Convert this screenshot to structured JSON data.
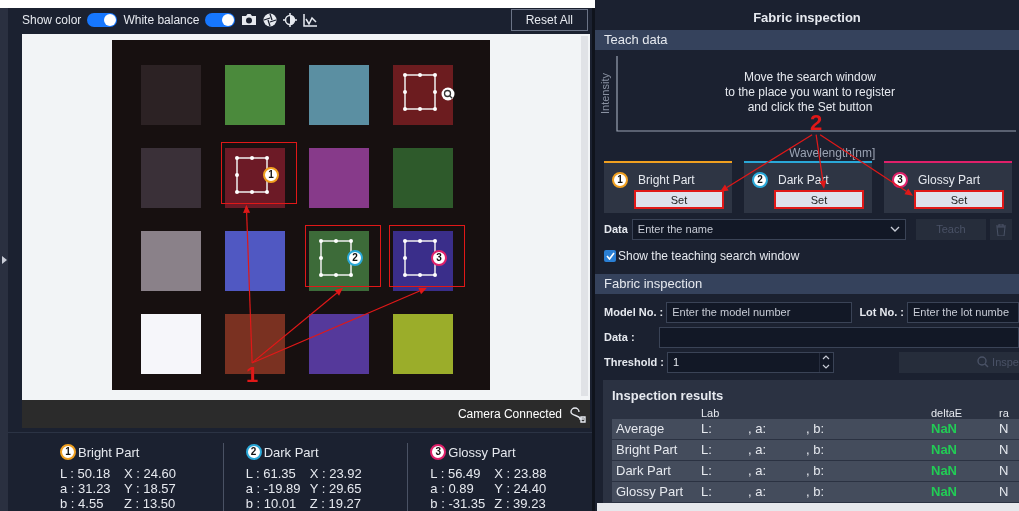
{
  "toolbar": {
    "toggles": [
      {
        "label": "Show color",
        "on": true
      },
      {
        "label": "White balance",
        "on": true
      }
    ],
    "reset_button": "Reset All"
  },
  "camera_image": {
    "patches": [
      {
        "color": "#2c2224",
        "highlighted": false,
        "search_window": false
      },
      {
        "color": "#4b8a3c",
        "highlighted": false,
        "search_window": false
      },
      {
        "color": "#5b8fa2",
        "highlighted": false,
        "search_window": false
      },
      {
        "color": "#6c1c1f",
        "highlighted": false,
        "search_window": true
      },
      {
        "color": "#3a3038",
        "highlighted": false,
        "search_window": false
      },
      {
        "color": "#6c1a26",
        "highlighted": true,
        "search_window": true,
        "marker": {
          "label": "1",
          "color": "#f0a020"
        }
      },
      {
        "color": "#873a8a",
        "highlighted": false,
        "search_window": false
      },
      {
        "color": "#2e5a2b",
        "highlighted": false,
        "search_window": false
      },
      {
        "color": "#8a8189",
        "highlighted": false,
        "search_window": false
      },
      {
        "color": "#5058c2",
        "highlighted": false,
        "search_window": false
      },
      {
        "color": "#3d6b39",
        "highlighted": true,
        "search_window": true,
        "marker": {
          "label": "2",
          "color": "#2aa8d8"
        }
      },
      {
        "color": "#3a2e8a",
        "highlighted": true,
        "search_window": true,
        "marker": {
          "label": "3",
          "color": "#e0206a"
        }
      },
      {
        "color": "#f6f6fa",
        "highlighted": false,
        "search_window": false
      },
      {
        "color": "#7a3121",
        "highlighted": false,
        "search_window": false
      },
      {
        "color": "#55399b",
        "highlighted": false,
        "search_window": false
      },
      {
        "color": "#9bad2a",
        "highlighted": false,
        "search_window": false
      }
    ],
    "callout": "1",
    "status": "Camera Connected"
  },
  "readings": [
    {
      "marker": "1",
      "color": "#f0a020",
      "name": "Bright Part",
      "lab": [
        "L : 50.18",
        "a : 31.23",
        "b : 4.55"
      ],
      "xyz": [
        "X : 24.60",
        "Y : 18.57",
        "Z : 13.50"
      ]
    },
    {
      "marker": "2",
      "color": "#2aa8d8",
      "name": "Dark Part",
      "lab": [
        "L : 61.35",
        "a : -19.89",
        "b : 10.01"
      ],
      "xyz": [
        "X : 23.92",
        "Y : 29.65",
        "Z : 19.27"
      ]
    },
    {
      "marker": "3",
      "color": "#e0206a",
      "name": "Glossy Part",
      "lab": [
        "L : 56.49",
        "a : 0.89",
        "b : -31.35"
      ],
      "xyz": [
        "X : 23.88",
        "Y : 24.40",
        "Z : 39.23"
      ]
    }
  ],
  "panel": {
    "title": "Fabric inspection",
    "teach": {
      "header": "Teach data",
      "y_axis": "Intensity",
      "x_axis": "Wavelength[nm]",
      "message": "Move the search window\nto the place you want to register\nand click the Set button",
      "callout": "2",
      "parts": [
        {
          "marker": "1",
          "color": "#f0a020",
          "name": "Bright Part",
          "button": "Set",
          "highlighted": true
        },
        {
          "marker": "2",
          "color": "#2aa8d8",
          "name": "Dark Part",
          "button": "Set",
          "highlighted": true
        },
        {
          "marker": "3",
          "color": "#e0206a",
          "name": "Glossy Part",
          "button": "Set",
          "highlighted": true
        }
      ],
      "data_label": "Data",
      "data_placeholder": "Enter the name",
      "teach_button": {
        "label": "Teach",
        "disabled": true
      },
      "delete_disabled": true,
      "show_window": {
        "label": "Show the teaching search window",
        "checked": true
      }
    },
    "inspection": {
      "header": "Fabric inspection",
      "model_label": "Model No. :",
      "model_placeholder": "Enter the model number",
      "lot_label": "Lot No. :",
      "lot_placeholder": "Enter the lot numbe",
      "data_label": "Data :",
      "threshold_label": "Threshold :",
      "threshold": "1",
      "inspect_button": {
        "label": "Inspe",
        "disabled": true
      },
      "results": {
        "title": "Inspection results",
        "columns": [
          "Lab",
          "deltaE",
          "ra"
        ],
        "rows": [
          {
            "name": "Average",
            "l": "L:",
            "a": ", a:",
            "b": ", b:",
            "delta_e": "NaN",
            "column_3": "N"
          },
          {
            "name": "Bright Part",
            "l": "L:",
            "a": ", a:",
            "b": ", b:",
            "delta_e": "NaN",
            "column_3": "N"
          },
          {
            "name": "Dark Part",
            "l": "L:",
            "a": ", a:",
            "b": ", b:",
            "delta_e": "NaN",
            "column_3": "N"
          },
          {
            "name": "Glossy Part",
            "l": "L:",
            "a": ", a:",
            "b": ", b:",
            "delta_e": "NaN",
            "column_3": "N"
          }
        ]
      }
    }
  }
}
